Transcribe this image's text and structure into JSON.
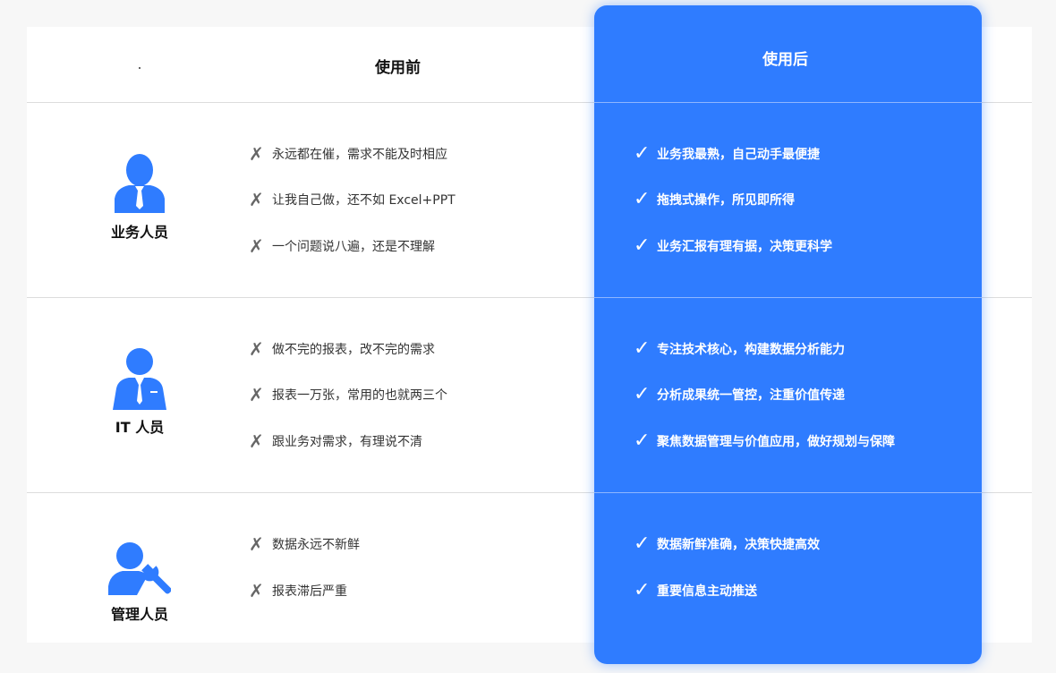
{
  "header": {
    "before_label": "使用前",
    "after_label": "使用后"
  },
  "icons": {
    "cross_glyph": "✗",
    "check_glyph": "✓",
    "accent_color": "#2f7cff"
  },
  "rows": [
    {
      "role": "业务人员",
      "icon": "business-person-icon",
      "before": [
        "永远都在催，需求不能及时相应",
        "让我自己做，还不如 Excel+PPT",
        "一个问题说八遍，还是不理解"
      ],
      "after": [
        "业务我最熟，自己动手最便捷",
        "拖拽式操作，所见即所得",
        "业务汇报有理有据，决策更科学"
      ]
    },
    {
      "role": "IT 人员",
      "icon": "it-person-icon",
      "before": [
        "做不完的报表，改不完的需求",
        "报表一万张，常用的也就两三个",
        "跟业务对需求，有理说不清"
      ],
      "after": [
        "专注技术核心，构建数据分析能力",
        "分析成果统一管控，注重价值传递",
        "聚焦数据管理与价值应用，做好规划与保障"
      ]
    },
    {
      "role": "管理人员",
      "icon": "manager-wrench-icon",
      "before": [
        "数据永远不新鲜",
        "报表滞后严重"
      ],
      "after": [
        "数据新鲜准确，决策快捷高效",
        "重要信息主动推送"
      ]
    }
  ]
}
